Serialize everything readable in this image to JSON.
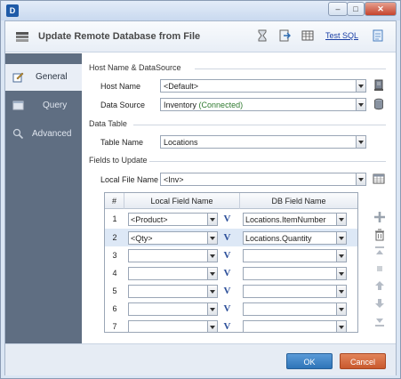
{
  "window": {
    "app_icon_letter": "D",
    "controls": {
      "minimize": "–",
      "maximize": "□",
      "close": "✕"
    }
  },
  "header": {
    "title": "Update Remote Database from File",
    "toolbar_icons": [
      "hourglass-icon",
      "import-icon",
      "grid-icon"
    ],
    "test_sql_label": "Test SQL",
    "notes_icon": "notepad-icon"
  },
  "sidebar": {
    "items": [
      {
        "label": "General",
        "icon": "pencil-paper-icon",
        "active": true
      },
      {
        "label": "Query",
        "icon": "window-icon",
        "active": false
      },
      {
        "label": "Advanced",
        "icon": "magnifier-icon",
        "active": false
      }
    ]
  },
  "host": {
    "section_title": "Host Name & DataSource",
    "host_name_label": "Host Name",
    "host_name_value": "<Default>",
    "data_source_label": "Data Source",
    "data_source_name": "Inventory",
    "data_source_status": "(Connected)"
  },
  "data_table": {
    "section_title": "Data Table",
    "table_name_label": "Table Name",
    "table_name_value": "Locations"
  },
  "fields": {
    "section_title": "Fields to Update",
    "local_file_label": "Local File Name",
    "local_file_value": "<Inv>",
    "columns": [
      "#",
      "Local Field Name",
      "DB Field Name"
    ],
    "rows": [
      {
        "num": "1",
        "local": "<Product>",
        "db": "Locations.ItemNumber",
        "selected": false
      },
      {
        "num": "2",
        "local": "<Qty>",
        "db": "Locations.Quantity",
        "selected": true
      },
      {
        "num": "3",
        "local": "",
        "db": "",
        "selected": false
      },
      {
        "num": "4",
        "local": "",
        "db": "",
        "selected": false
      },
      {
        "num": "5",
        "local": "",
        "db": "",
        "selected": false
      },
      {
        "num": "6",
        "local": "",
        "db": "",
        "selected": false
      },
      {
        "num": "7",
        "local": "",
        "db": "",
        "selected": false
      }
    ],
    "variable_button": "V"
  },
  "footer": {
    "ok_label": "OK",
    "cancel_label": "Cancel"
  }
}
